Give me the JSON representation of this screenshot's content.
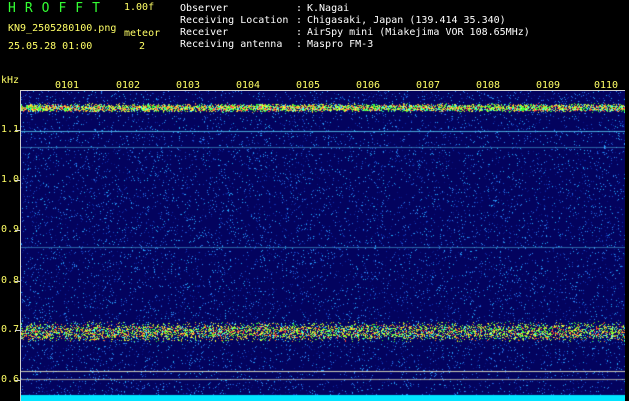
{
  "header": {
    "app_title": "HROFFT",
    "version": "1.00f",
    "filename": "KN9_2505280100.png",
    "meteor_label": "meteor",
    "meteor_count": "2",
    "datetime": "25.05.28 01:00",
    "meta": [
      {
        "label": "Observer",
        "value": "K.Nagai"
      },
      {
        "label": "Receiving Location",
        "value": "Chigasaki, Japan (139.414 35.340)"
      },
      {
        "label": "Receiver",
        "value": "AirSpy mini (Miakejima VOR 108.65MHz)"
      },
      {
        "label": "Receiving antenna",
        "value": "Maspro FM-3"
      }
    ]
  },
  "plot": {
    "y_unit": "kHz",
    "y_ticks": [
      "1.1",
      "1.0",
      "0.9",
      "0.8",
      "0.7",
      "0.6"
    ],
    "x_ticks": [
      "0101",
      "0102",
      "0103",
      "0104",
      "0105",
      "0106",
      "0107",
      "0108",
      "0109",
      "0110"
    ],
    "colors": {
      "background": "#03035e",
      "label": "#ffff66",
      "axis": "#cfcfcf"
    }
  }
}
